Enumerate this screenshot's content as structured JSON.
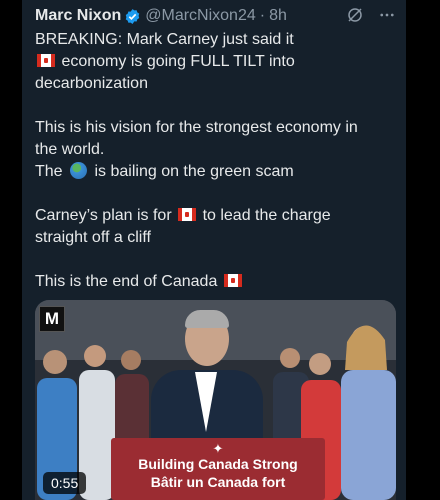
{
  "tweet": {
    "author_name": "Marc Nixon",
    "handle": "@MarcNixon24",
    "separator": "·",
    "time": "8h",
    "lines": {
      "l1": "BREAKING: Mark Carney just said it",
      "l2": "economy is going FULL TILT into",
      "l3": "decarbonization",
      "l4": "This is his vision for the strongest economy in",
      "l5": "the world.",
      "l6a": "The",
      "l6b": "is bailing on the green scam",
      "l7a": "Carney’s plan is for",
      "l7b": "to lead the charge",
      "l8": "straight off a cliff",
      "l9": "This is the end of Canada"
    },
    "icons": [
      "verified-badge-icon",
      "grok-icon",
      "more-icon",
      "canada-flag-icon",
      "globe-icon"
    ]
  },
  "media": {
    "logo": "M",
    "podium_line1": "Building Canada Strong",
    "podium_line2": "Bâtir un Canada fort",
    "duration": "0:55"
  },
  "colors": {
    "background": "#15202b",
    "verified": "#1d9bf0",
    "text": "#e7e9ea",
    "muted": "#8b98a5",
    "podium": "#9b2c32"
  }
}
